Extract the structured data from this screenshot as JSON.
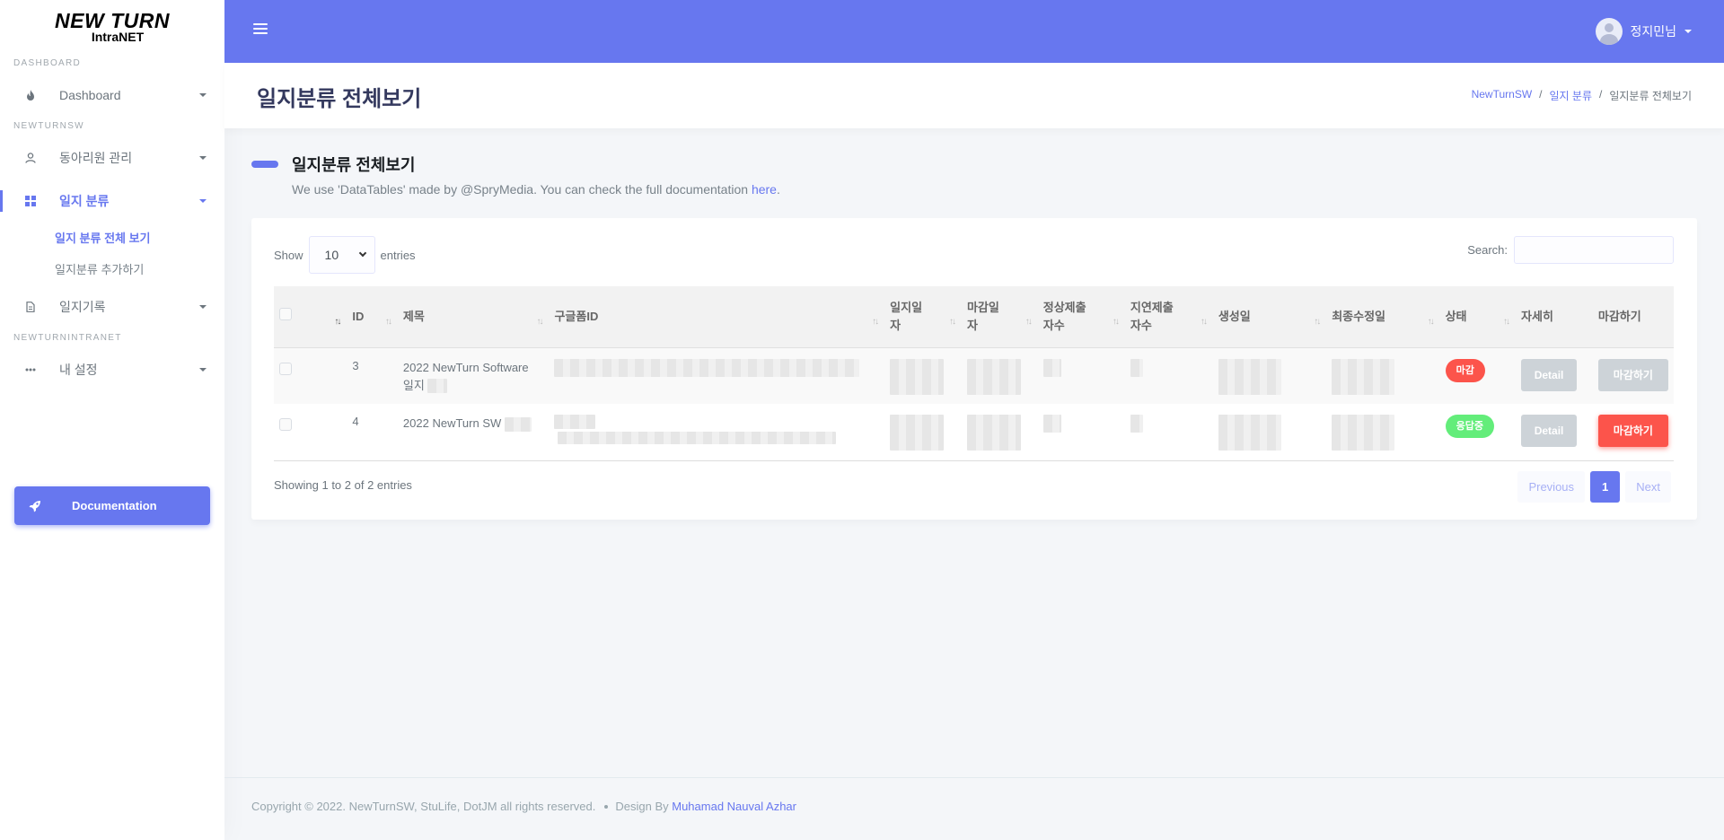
{
  "brand": {
    "line1": "NEW TURN",
    "line2": "IntraNET"
  },
  "sidebar": {
    "sections": [
      {
        "header": "DASHBOARD"
      },
      {
        "header": "NEWTURNSW"
      },
      {
        "header": "NEWTURNINTRANET"
      }
    ],
    "items": [
      {
        "label": "Dashboard",
        "icon": "fire-icon"
      },
      {
        "label": "동아리원 관리",
        "icon": "user-icon"
      },
      {
        "label": "일지 분류",
        "icon": "grid-icon"
      },
      {
        "label": "일지기록",
        "icon": "file-icon"
      },
      {
        "label": "내 설정",
        "icon": "ellipsis-icon"
      }
    ],
    "submenu": [
      {
        "label": "일지 분류 전체 보기"
      },
      {
        "label": "일지분류 추가하기"
      }
    ],
    "doc_button": "Documentation"
  },
  "navbar": {
    "user_name": "정지민님"
  },
  "header": {
    "title": "일지분류 전체보기",
    "breadcrumb": [
      "NewTurnSW",
      "일지 분류",
      "일지분류 전체보기"
    ]
  },
  "section": {
    "title": "일지분류 전체보기",
    "lead_prefix": "We use 'DataTables' made by @SpryMedia. You can check the full documentation ",
    "lead_link": "here",
    "lead_suffix": "."
  },
  "table_controls": {
    "show_label": "Show",
    "entries_value": "10",
    "entries_label": "entries",
    "search_label": "Search:"
  },
  "table": {
    "columns": [
      "",
      "ID",
      "제목",
      "구글폼ID",
      "일지일\n자",
      "마감일\n자",
      "정상제출\n자수",
      "지연제출\n자수",
      "생성일",
      "최종수정일",
      "상태",
      "자세히",
      "마감하기"
    ],
    "rows": [
      {
        "id": "3",
        "title_line1": "2022 NewTurn Software",
        "title_line2": "일지",
        "status": "마감",
        "detail": "Detail",
        "close": "마감하기"
      },
      {
        "id": "4",
        "title_line1": "2022 NewTurn SW",
        "title_line2": "",
        "status": "응답중",
        "detail": "Detail",
        "close": "마감하기"
      }
    ]
  },
  "pagination": {
    "info": "Showing 1 to 2 of 2 entries",
    "previous": "Previous",
    "current": "1",
    "next": "Next"
  },
  "footer": {
    "copyright": "Copyright © 2022. NewTurnSW, StuLife, DotJM all rights reserved.",
    "design_by": "Design By",
    "author": "Muhamad Nauval Azhar"
  },
  "colors": {
    "primary": "#6777ef",
    "danger": "#fc544b",
    "success": "#63ed7a"
  }
}
